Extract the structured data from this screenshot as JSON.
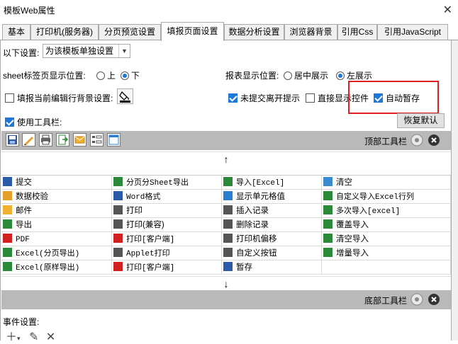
{
  "window": {
    "title": "模板Web属性",
    "close_glyph": "✕"
  },
  "tabs": [
    "基本",
    "打印机(服务器)",
    "分页预览设置",
    "填报页面设置",
    "数据分析设置",
    "浏览器背景",
    "引用Css",
    "引用JavaScript"
  ],
  "settings": {
    "scope_label": "以下设置:",
    "scope_value": "为该模板单独设置",
    "sheet_pos_label": "sheet标签页显示位置:",
    "sheet_pos_top": "上",
    "sheet_pos_bottom": "下",
    "report_pos_label": "报表显示位置:",
    "report_pos_center": "居中展示",
    "report_pos_left": "左展示",
    "fill_row_bg_label": "填报当前编辑行背景设置:",
    "unsubmitted_label": "未提交离开提示",
    "direct_show_label": "直接显示控件",
    "autosave_label": "自动暂存",
    "use_toolbar_label": "使用工具栏:",
    "restore_default": "恢复默认"
  },
  "top_toolbar_label": "顶部工具栏",
  "bottom_toolbar_label": "底部工具栏",
  "arrow_up": "↑",
  "arrow_down": "↓",
  "grid": [
    [
      "提交",
      "分页分Sheet导出",
      "导入[Excel]",
      "清空"
    ],
    [
      "数据校验",
      "Word格式",
      "显示单元格值",
      "自定义导入Excel行列"
    ],
    [
      "邮件",
      "打印",
      "插入记录",
      "多次导入[excel]"
    ],
    [
      "导出",
      "打印(兼容)",
      "删除记录",
      "覆盖导入"
    ],
    [
      "PDF",
      "打印[客户端]",
      "打印机偏移",
      "清空导入"
    ],
    [
      "Excel(分页导出)",
      "Applet打印",
      "自定义按钮",
      "增量导入"
    ],
    [
      "Excel(原样导出)",
      "打印[客户端]",
      "暂存",
      ""
    ]
  ],
  "events_label": "事件设置:"
}
